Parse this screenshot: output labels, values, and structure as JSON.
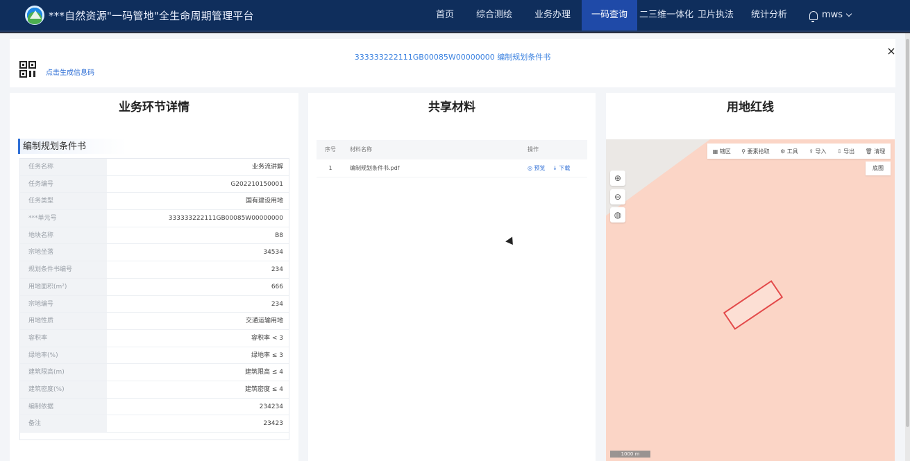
{
  "header": {
    "title": "***自然资源\"一码管地\"全生命周期管理平台",
    "nav": [
      {
        "label": "首页",
        "active": false
      },
      {
        "label": "综合测绘",
        "active": false
      },
      {
        "label": "业务办理",
        "active": false
      },
      {
        "label": "一码查询",
        "active": true
      },
      {
        "label": "二三维一体化",
        "active": false
      },
      {
        "label": "卫片执法",
        "active": false
      },
      {
        "label": "统计分析",
        "active": false
      }
    ],
    "user": "mws"
  },
  "modal": {
    "doc_title": "333333222111GB00085W00000000 编制规划条件书",
    "qr_link": "点击生成信息码",
    "close": "×"
  },
  "left_panel": {
    "title": "业务环节详情",
    "section": "编制规划条件书",
    "rows": [
      {
        "k": "任务名称",
        "v": "业务流讲解"
      },
      {
        "k": "任务编号",
        "v": "G202210150001"
      },
      {
        "k": "任务类型",
        "v": "国有建设用地"
      },
      {
        "k": "***单元号",
        "v": "333333222111GB00085W00000000"
      },
      {
        "k": "地块名称",
        "v": "B8"
      },
      {
        "k": "宗地坐落",
        "v": "34534"
      },
      {
        "k": "规划条件书编号",
        "v": "234"
      },
      {
        "k": "用地面积(m²)",
        "v": "666"
      },
      {
        "k": "宗地编号",
        "v": "234"
      },
      {
        "k": "用地性质",
        "v": "交通运输用地"
      },
      {
        "k": "容积率",
        "v": "容积率 < 3"
      },
      {
        "k": "绿地率(%)",
        "v": "绿地率 ≤ 3"
      },
      {
        "k": "建筑限高(m)",
        "v": "建筑限高 ≤ 4"
      },
      {
        "k": "建筑密度(%)",
        "v": "建筑密度 ≤ 4"
      },
      {
        "k": "编制依据",
        "v": "234234"
      },
      {
        "k": "备注",
        "v": "23423"
      }
    ]
  },
  "middle_panel": {
    "title": "共享材料",
    "headers": {
      "no": "序号",
      "name": "材料名称",
      "op": "操作"
    },
    "rows": [
      {
        "no": "1",
        "name": "编制规划条件书.pdf",
        "preview": "◎ 预览",
        "download": "↓ 下载"
      }
    ]
  },
  "right_panel": {
    "title": "用地红线",
    "toolbar": [
      "▦ 辖区",
      "⚲ 要素拾取",
      "⚙ 工具",
      "⇪ 导入",
      "⇩ 导出",
      "🗑 清理"
    ],
    "basemap": "底图",
    "scale": "1000 m",
    "colors": {
      "parcel": "#e34a4a",
      "fill": "#fbd5c6"
    }
  }
}
